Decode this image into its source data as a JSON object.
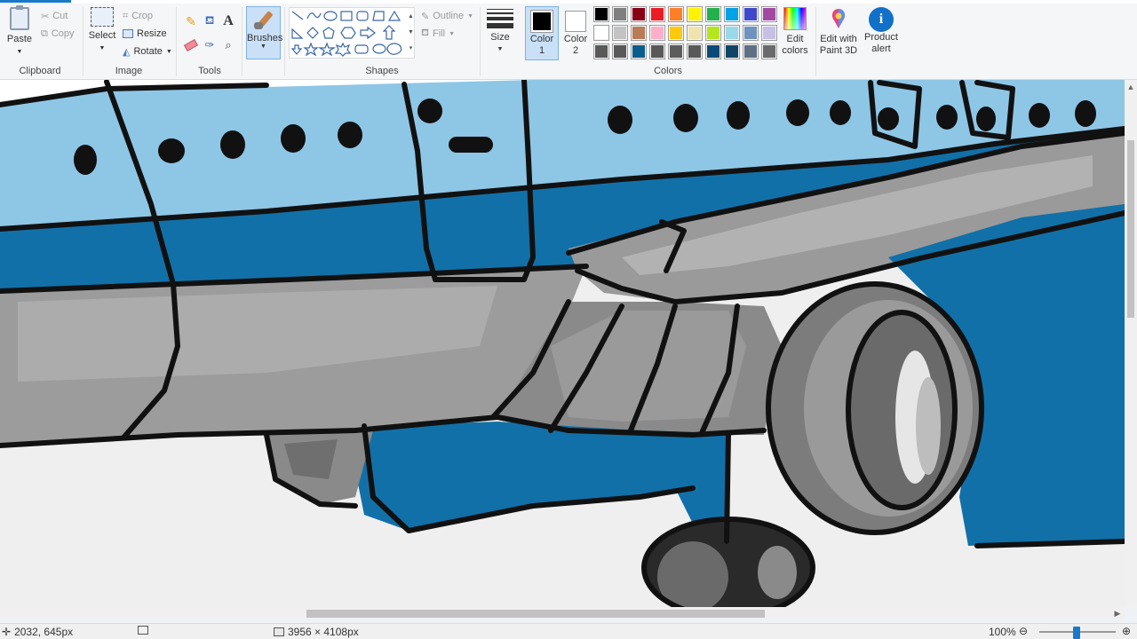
{
  "ribbon": {
    "clipboard": {
      "paste": "Paste",
      "cut": "Cut",
      "copy": "Copy",
      "label": "Clipboard"
    },
    "image": {
      "select": "Select",
      "crop": "Crop",
      "resize": "Resize",
      "rotate": "Rotate",
      "label": "Image"
    },
    "tools": {
      "label": "Tools"
    },
    "brushes": {
      "label": "Brushes"
    },
    "shapes": {
      "outline": "Outline",
      "fill": "Fill",
      "label": "Shapes"
    },
    "size": {
      "label": "Size"
    },
    "colors": {
      "color1": "Color",
      "color1_num": "1",
      "color2": "Color",
      "color2_num": "2",
      "color1_value": "#000000",
      "color2_value": "#ffffff",
      "edit_colors": "Edit",
      "edit_colors_2": "colors",
      "label": "Colors",
      "palette": [
        "#000000",
        "#7f7f7f",
        "#880015",
        "#ed1c24",
        "#ff7f27",
        "#fff200",
        "#22b14c",
        "#00a2e8",
        "#3f48cc",
        "#a349a4",
        "#ffffff",
        "#c3c3c3",
        "#b97a57",
        "#ffaec9",
        "#ffc90e",
        "#efe4b0",
        "#b5e61d",
        "#99d9ea",
        "#7092be",
        "#c8bfe7",
        "#595959",
        "#595959",
        "#0a5c8c",
        "#595959",
        "#5c5c5c",
        "#595959",
        "#0a4a74",
        "#0e4566",
        "#5f6f84",
        "#6a6a6a"
      ]
    },
    "paint3d": {
      "line1": "Edit with",
      "line2": "Paint 3D"
    },
    "product_alert": {
      "line1": "Product",
      "line2": "alert"
    }
  },
  "status": {
    "cursor_pos": "2032, 645px",
    "selection_size": "",
    "image_size": "3956 × 4108px",
    "zoom": "100%"
  }
}
